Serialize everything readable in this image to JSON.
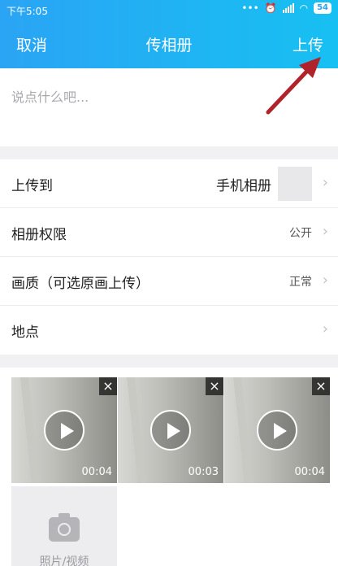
{
  "status_bar": {
    "time": "下午5:05",
    "battery": "54"
  },
  "header": {
    "cancel": "取消",
    "title": "传相册",
    "upload": "上传"
  },
  "compose": {
    "placeholder": "说点什么吧..."
  },
  "settings": [
    {
      "label": "上传到",
      "value": "手机相册"
    },
    {
      "label": "相册权限",
      "value": "公开"
    },
    {
      "label": "画质（可选原画上传）",
      "value": "正常"
    },
    {
      "label": "地点",
      "value": ""
    }
  ],
  "media": {
    "videos": [
      {
        "duration": "00:04",
        "close": "×"
      },
      {
        "duration": "00:03",
        "close": "×"
      },
      {
        "duration": "00:04",
        "close": "×"
      }
    ],
    "add_label": "照片/视频"
  },
  "colors": {
    "header_start": "#2aa4f4",
    "header_end": "#17c0f2",
    "annotation_arrow": "#b0232a"
  }
}
